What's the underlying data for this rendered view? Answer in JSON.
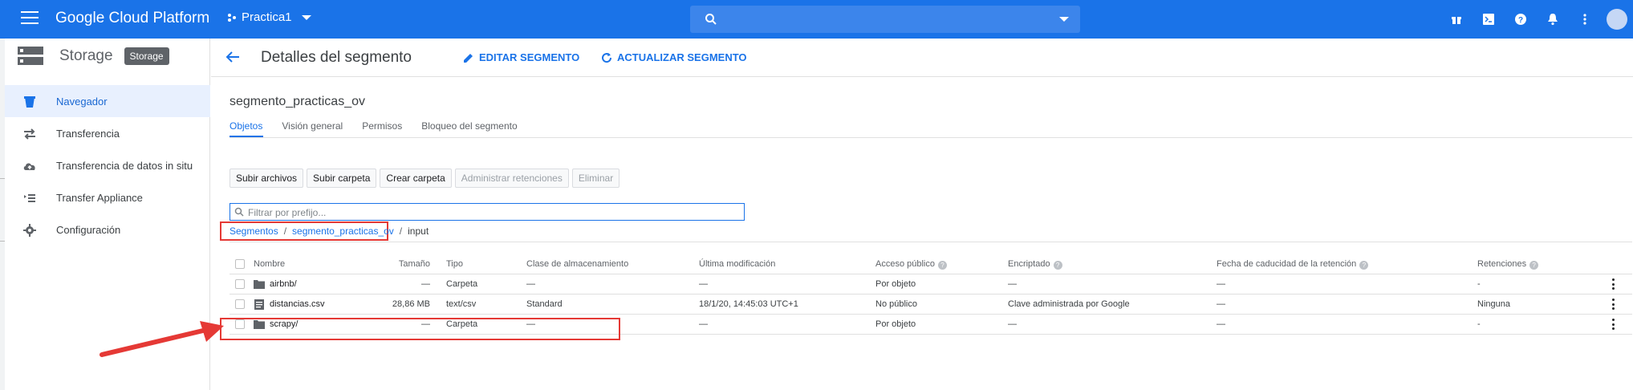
{
  "topbar": {
    "brand": "Google Cloud Platform",
    "project": "Practica1"
  },
  "sidebar": {
    "title": "Storage",
    "badge": "Storage",
    "items": [
      {
        "label": "Navegador",
        "icon": "bucket-icon"
      },
      {
        "label": "Transferencia",
        "icon": "transfer-arrows-icon"
      },
      {
        "label": "Transferencia de datos in situ",
        "icon": "cloud-upload-icon"
      },
      {
        "label": "Transfer Appliance",
        "icon": "list-icon"
      },
      {
        "label": "Configuración",
        "icon": "gear-icon"
      }
    ]
  },
  "header": {
    "title": "Detalles del segmento",
    "edit_label": "EDITAR SEGMENTO",
    "refresh_label": "ACTUALIZAR SEGMENTO"
  },
  "bucket": {
    "name": "segmento_practicas_ov",
    "tabs": [
      "Objetos",
      "Visión general",
      "Permisos",
      "Bloqueo del segmento"
    ]
  },
  "buttons": {
    "upload_files": "Subir archivos",
    "upload_folder": "Subir carpeta",
    "create_folder": "Crear carpeta",
    "manage_retention": "Administrar retenciones",
    "delete": "Eliminar"
  },
  "filter": {
    "placeholder": "Filtrar por prefijo..."
  },
  "breadcrumb": {
    "root": "Segmentos",
    "bucket": "segmento_practicas_ov",
    "current": "input",
    "separator": "/"
  },
  "table": {
    "headers": {
      "name": "Nombre",
      "size": "Tamaño",
      "type": "Tipo",
      "storage_class": "Clase de almacenamiento",
      "modified": "Última modificación",
      "public": "Acceso público",
      "encryption": "Encriptado",
      "retention_expiry": "Fecha de caducidad de la retención",
      "holds": "Retenciones"
    },
    "rows": [
      {
        "name": "airbnb/",
        "size": "—",
        "type": "Carpeta",
        "storage_class": "—",
        "modified": "—",
        "public": "Por objeto",
        "encryption": "—",
        "retention_expiry": "—",
        "holds": "-"
      },
      {
        "name": "distancias.csv",
        "size": "28,86 MB",
        "type": "text/csv",
        "storage_class": "Standard",
        "modified": "18/1/20, 14:45:03 UTC+1",
        "public": "No público",
        "encryption": "Clave administrada por Google",
        "retention_expiry": "—",
        "holds": "Ninguna"
      },
      {
        "name": "scrapy/",
        "size": "—",
        "type": "Carpeta",
        "storage_class": "—",
        "modified": "—",
        "public": "Por objeto",
        "encryption": "—",
        "retention_expiry": "—",
        "holds": "-"
      }
    ]
  },
  "colors": {
    "brand_blue": "#1a73e8",
    "annotation_red": "#e53935"
  }
}
